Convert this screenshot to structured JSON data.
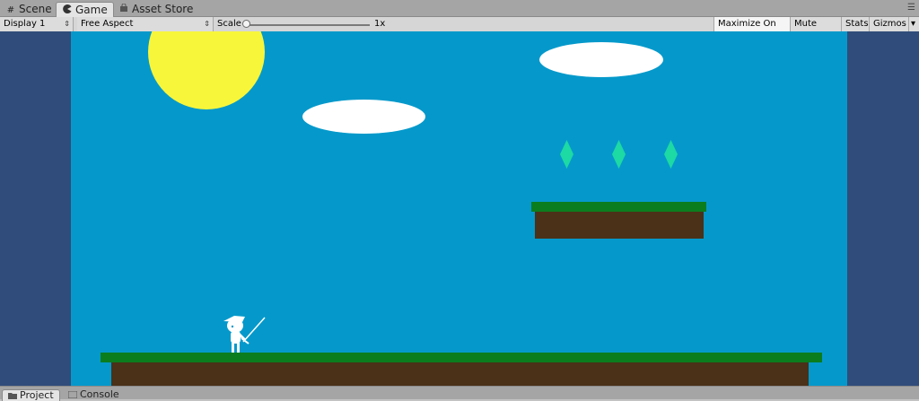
{
  "tabs": [
    {
      "label": "Scene",
      "icon": "hash-icon",
      "active": false
    },
    {
      "label": "Game",
      "icon": "pacman-icon",
      "active": true
    },
    {
      "label": "Asset Store",
      "icon": "shopping-bag-icon",
      "active": false
    }
  ],
  "window_menu_icon": "window-menu-icon",
  "toolbar": {
    "display": "Display 1",
    "aspect": "Free Aspect",
    "scale_label": "Scale",
    "scale_value": "1x",
    "maximize_on_play": "Maximize On Play",
    "mute_audio": "Mute Audio",
    "stats": "Stats",
    "gizmos": "Gizmos"
  },
  "bottom_tabs": [
    {
      "label": "Project",
      "icon": "folder-icon",
      "active": true
    },
    {
      "label": "Console",
      "icon": "console-icon",
      "active": false
    }
  ],
  "game": {
    "sky_color": "#0599cb",
    "letterbox_color": "#304c7a",
    "sun_color": "#f8f63a",
    "gem_color": "#1dd9a4",
    "grass_color": "#0c7d1e",
    "dirt_color": "#4a3117",
    "gem_count": 3,
    "cloud_count": 2
  }
}
